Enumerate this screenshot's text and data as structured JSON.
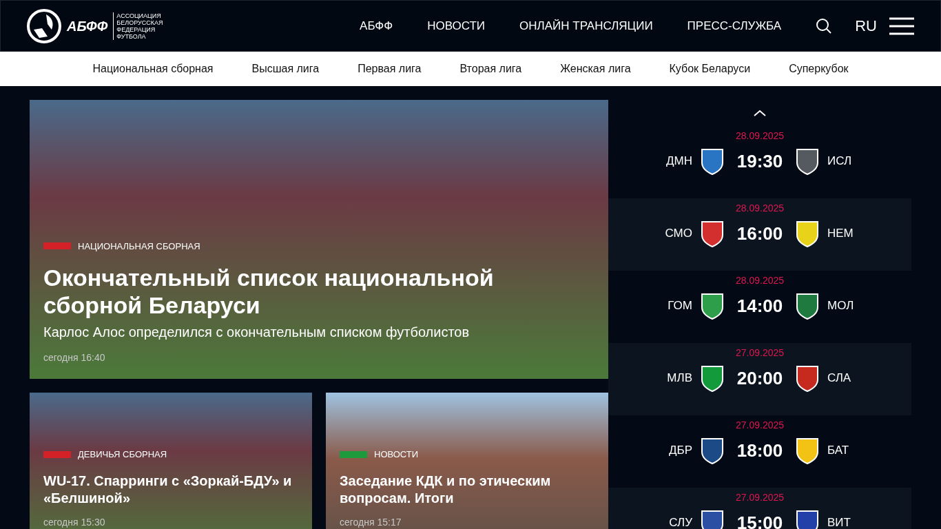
{
  "header": {
    "logo": {
      "abbr": "АБФФ",
      "lines": [
        "АССОЦИАЦИЯ",
        "БЕЛОРУССКАЯ",
        "ФЕДЕРАЦИЯ",
        "ФУТБОЛА"
      ]
    },
    "nav": [
      "АБФФ",
      "НОВОСТИ",
      "ОНЛАЙН ТРАНСЛЯЦИИ",
      "ПРЕСС-СЛУЖБА"
    ],
    "language": "RU"
  },
  "subnav": [
    "Национальная сборная",
    "Высшая лига",
    "Первая лига",
    "Вторая лига",
    "Женская лига",
    "Кубок Беларуси",
    "Суперкубок"
  ],
  "featured": {
    "category": {
      "label": "НАЦИОНАЛЬНАЯ СБОРНАЯ",
      "color": "#d42027"
    },
    "title": "Окончательный список национальной сборной Беларуси",
    "subtitle": "Карлос Алос определился с окончательным списком футболистов",
    "time": "сегодня 16:40"
  },
  "news": [
    {
      "category": {
        "label": "ДЕВИЧЬЯ СБОРНАЯ",
        "color": "#d42027"
      },
      "title": "WU-17. Спарринги с «Зоркай-БДУ» и «Белшиной»",
      "time": "сегодня 15:30"
    },
    {
      "category": {
        "label": "НОВОСТИ",
        "color": "#1c9a3c"
      },
      "title": "Заседание КДК и по этическим вопросам. Итоги",
      "time": "сегодня 15:17"
    }
  ],
  "matches": [
    {
      "date": "28.09.2025",
      "home": {
        "name": "ДМН",
        "color": "#2a74c4"
      },
      "time": "19:30",
      "away": {
        "name": "ИСЛ",
        "color": "#555a60"
      }
    },
    {
      "date": "28.09.2025",
      "home": {
        "name": "СМО",
        "color": "#d32f2f"
      },
      "time": "16:00",
      "away": {
        "name": "НЕМ",
        "color": "#e9d21a"
      }
    },
    {
      "date": "28.09.2025",
      "home": {
        "name": "ГОМ",
        "color": "#2f9e4a"
      },
      "time": "14:00",
      "away": {
        "name": "МОЛ",
        "color": "#1f7a3f"
      }
    },
    {
      "date": "27.09.2025",
      "home": {
        "name": "МЛВ",
        "color": "#139a3a"
      },
      "time": "20:00",
      "away": {
        "name": "СЛА",
        "color": "#c62a1e"
      }
    },
    {
      "date": "27.09.2025",
      "home": {
        "name": "ДБР",
        "color": "#1b4a86"
      },
      "time": "18:00",
      "away": {
        "name": "БАТ",
        "color": "#f2c315"
      }
    },
    {
      "date": "27.09.2025",
      "home": {
        "name": "СЛУ",
        "color": "#2b4fa3"
      },
      "time": "15:00",
      "away": {
        "name": "ВИТ",
        "color": "#2340a8"
      }
    }
  ]
}
